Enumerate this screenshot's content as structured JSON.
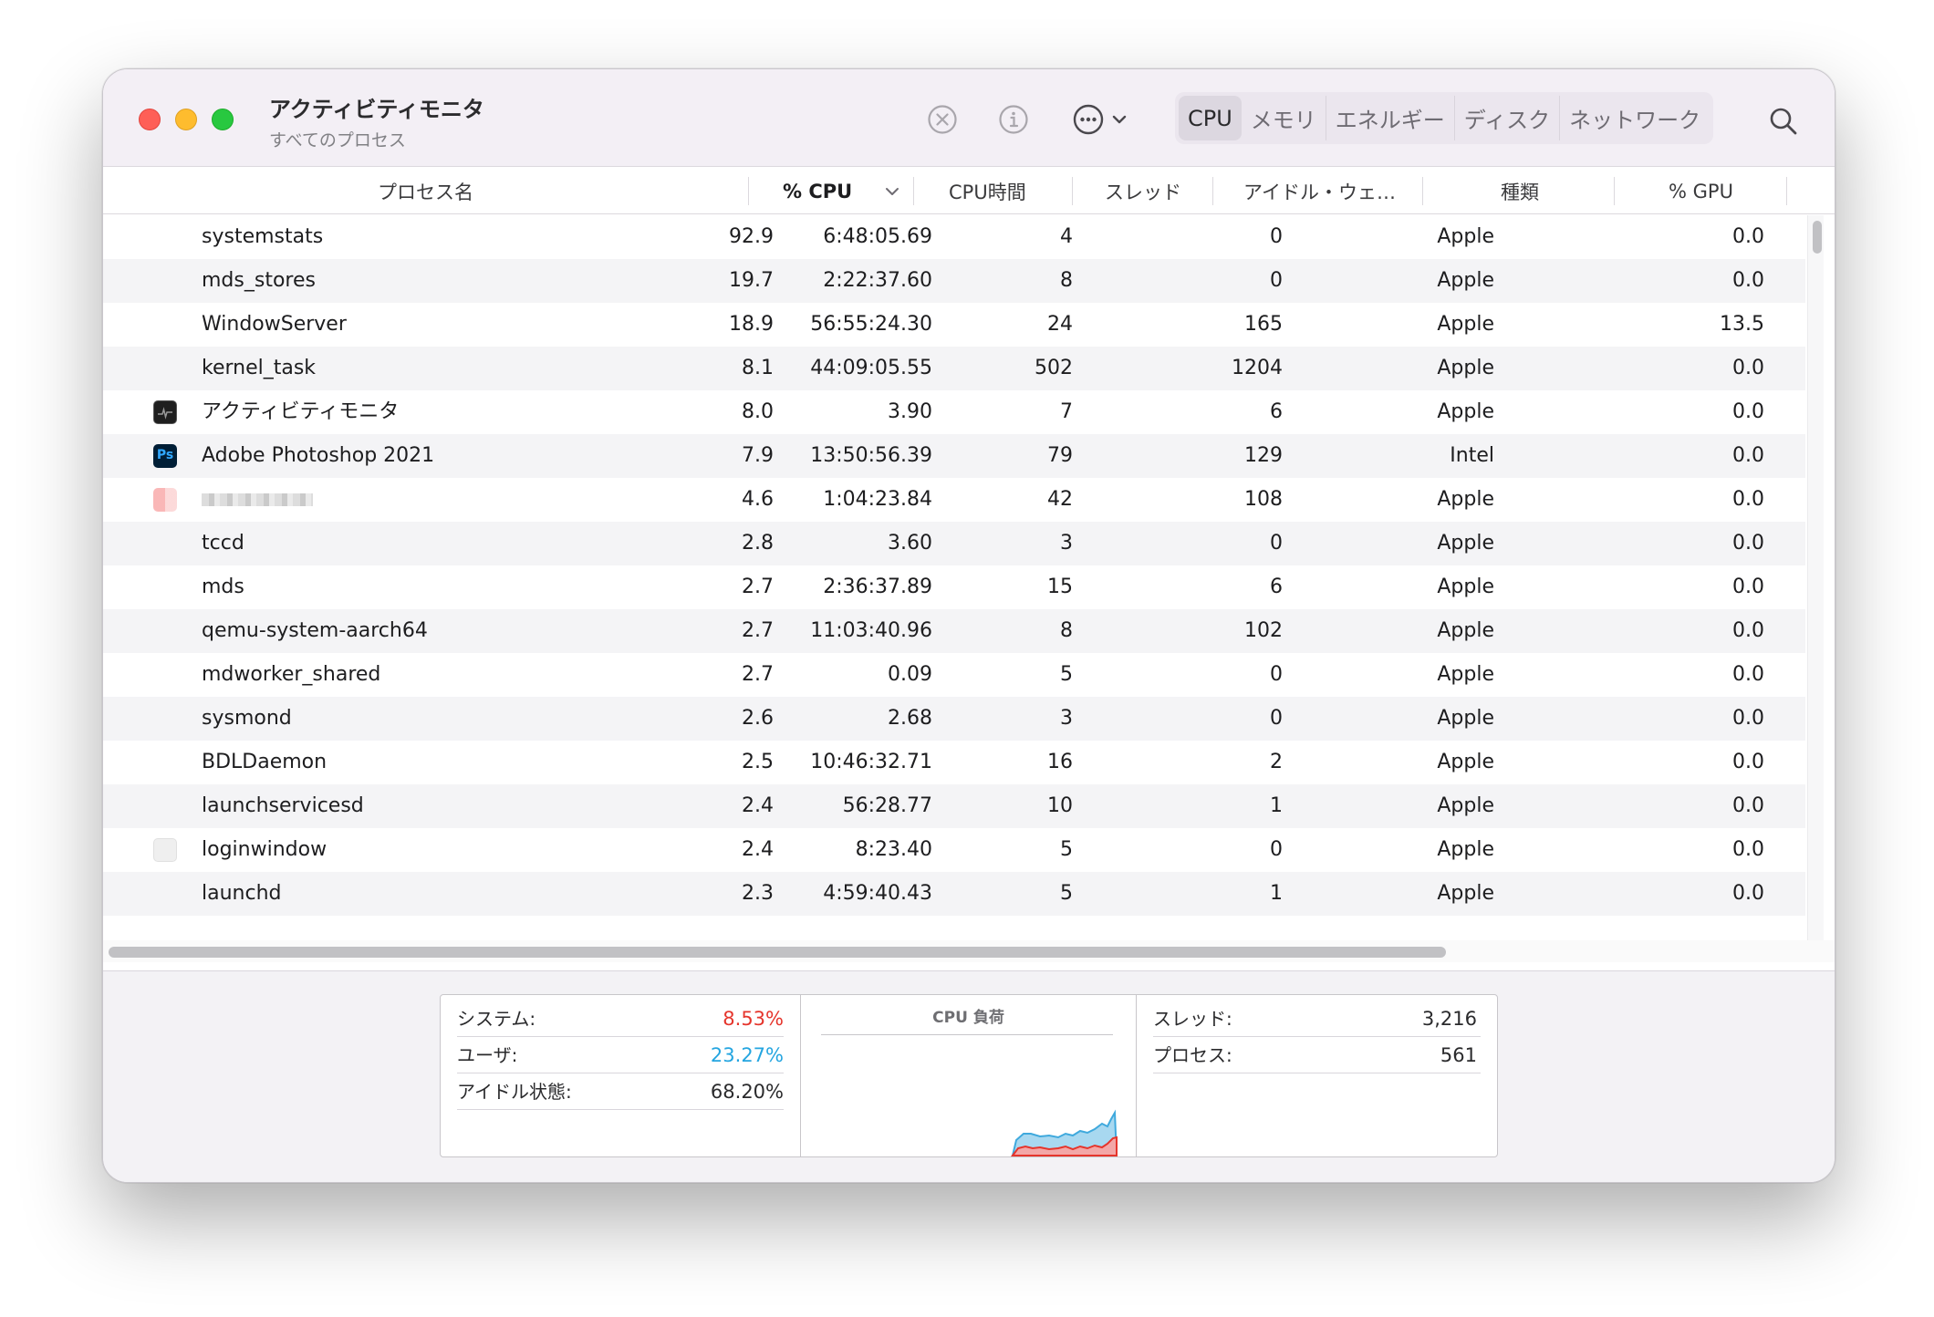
{
  "window": {
    "title": "アクティビティモニタ",
    "subtitle": "すべてのプロセス"
  },
  "toolbar": {
    "buttons": [
      {
        "name": "stop-process",
        "icon": "x-circle-icon"
      },
      {
        "name": "inspect-process",
        "icon": "info-icon"
      },
      {
        "name": "more-actions",
        "icon": "ellipsis-circle-icon"
      }
    ],
    "tabs": [
      {
        "label": "CPU",
        "active": true
      },
      {
        "label": "メモリ",
        "active": false
      },
      {
        "label": "エネルギー",
        "active": false
      },
      {
        "label": "ディスク",
        "active": false
      },
      {
        "label": "ネットワーク",
        "active": false
      }
    ],
    "search_icon": "magnifier-icon"
  },
  "table": {
    "columns": {
      "name": "プロセス名",
      "cpu": "% CPU",
      "cpu_time": "CPU時間",
      "threads": "スレッド",
      "idle_wake": "アイドル・ウェ…",
      "kind": "種類",
      "gpu": "% GPU"
    },
    "sort": {
      "column": "cpu",
      "direction": "descending"
    },
    "rows": [
      {
        "name": "systemstats",
        "cpu": "92.9",
        "time": "6:48:05.69",
        "threads": "4",
        "idle": "0",
        "kind": "Apple",
        "gpu": "0.0",
        "icon": ""
      },
      {
        "name": "mds_stores",
        "cpu": "19.7",
        "time": "2:22:37.60",
        "threads": "8",
        "idle": "0",
        "kind": "Apple",
        "gpu": "0.0",
        "icon": ""
      },
      {
        "name": "WindowServer",
        "cpu": "18.9",
        "time": "56:55:24.30",
        "threads": "24",
        "idle": "165",
        "kind": "Apple",
        "gpu": "13.5",
        "icon": ""
      },
      {
        "name": "kernel_task",
        "cpu": "8.1",
        "time": "44:09:05.55",
        "threads": "502",
        "idle": "1204",
        "kind": "Apple",
        "gpu": "0.0",
        "icon": ""
      },
      {
        "name": "アクティビティモニタ",
        "cpu": "8.0",
        "time": "3.90",
        "threads": "7",
        "idle": "6",
        "kind": "Apple",
        "gpu": "0.0",
        "icon": "activity-monitor-icon"
      },
      {
        "name": "Adobe Photoshop 2021",
        "cpu": "7.9",
        "time": "13:50:56.39",
        "threads": "79",
        "idle": "129",
        "kind": "Intel",
        "gpu": "0.0",
        "icon": "photoshop-icon"
      },
      {
        "name": "",
        "cpu": "4.6",
        "time": "1:04:23.84",
        "threads": "42",
        "idle": "108",
        "kind": "Apple",
        "gpu": "0.0",
        "icon": "blurred-app-icon",
        "blurred": true
      },
      {
        "name": "tccd",
        "cpu": "2.8",
        "time": "3.60",
        "threads": "3",
        "idle": "0",
        "kind": "Apple",
        "gpu": "0.0",
        "icon": ""
      },
      {
        "name": "mds",
        "cpu": "2.7",
        "time": "2:36:37.89",
        "threads": "15",
        "idle": "6",
        "kind": "Apple",
        "gpu": "0.0",
        "icon": ""
      },
      {
        "name": "qemu-system-aarch64",
        "cpu": "2.7",
        "time": "11:03:40.96",
        "threads": "8",
        "idle": "102",
        "kind": "Apple",
        "gpu": "0.0",
        "icon": ""
      },
      {
        "name": "mdworker_shared",
        "cpu": "2.7",
        "time": "0.09",
        "threads": "5",
        "idle": "0",
        "kind": "Apple",
        "gpu": "0.0",
        "icon": ""
      },
      {
        "name": "sysmond",
        "cpu": "2.6",
        "time": "2.68",
        "threads": "3",
        "idle": "0",
        "kind": "Apple",
        "gpu": "0.0",
        "icon": ""
      },
      {
        "name": "BDLDaemon",
        "cpu": "2.5",
        "time": "10:46:32.71",
        "threads": "16",
        "idle": "2",
        "kind": "Apple",
        "gpu": "0.0",
        "icon": ""
      },
      {
        "name": "launchservicesd",
        "cpu": "2.4",
        "time": "56:28.77",
        "threads": "10",
        "idle": "1",
        "kind": "Apple",
        "gpu": "0.0",
        "icon": ""
      },
      {
        "name": "loginwindow",
        "cpu": "2.4",
        "time": "8:23.40",
        "threads": "5",
        "idle": "0",
        "kind": "Apple",
        "gpu": "0.0",
        "icon": "loginwindow-icon"
      },
      {
        "name": "launchd",
        "cpu": "2.3",
        "time": "4:59:40.43",
        "threads": "5",
        "idle": "1",
        "kind": "Apple",
        "gpu": "0.0",
        "icon": ""
      }
    ]
  },
  "summary": {
    "system_label": "システム:",
    "system_value": "8.53%",
    "user_label": "ユーザ:",
    "user_value": "23.27%",
    "idle_label": "アイドル状態:",
    "idle_value": "68.20%",
    "graph_title": "CPU 負荷",
    "threads_label": "スレッド:",
    "threads_value": "3,216",
    "processes_label": "プロセス:",
    "processes_value": "561"
  },
  "colors": {
    "system": "#e5352c",
    "user": "#24a5e0",
    "close": "#fe5f57",
    "minimize": "#febc2e",
    "zoom": "#28c840"
  }
}
